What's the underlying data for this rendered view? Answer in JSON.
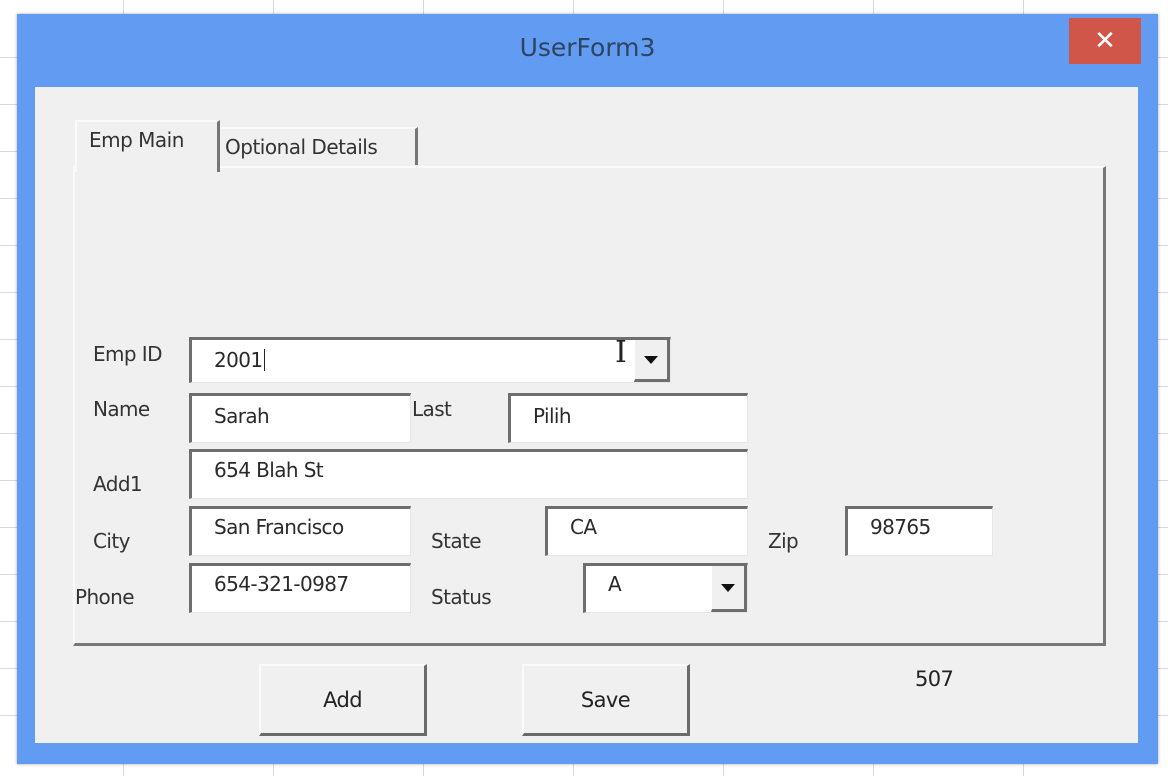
{
  "window": {
    "title": "UserForm3",
    "close_icon": "close-x-icon",
    "colors": {
      "titlebar": "#619cf2",
      "close": "#d0564a",
      "client": "#f0f0f0"
    }
  },
  "tabs": [
    {
      "label": "Emp Main",
      "active": true
    },
    {
      "label": "Optional Details",
      "active": false
    }
  ],
  "form": {
    "emp_id": {
      "label": "Emp ID",
      "value": "2001",
      "dropdown_icon": "dropdown-arrow-icon"
    },
    "name": {
      "label": "Name",
      "value": "Sarah"
    },
    "last": {
      "label": "Last",
      "value": "Pilih"
    },
    "add1": {
      "label": "Add1",
      "value": "654 Blah St"
    },
    "city": {
      "label": "City",
      "value": "San Francisco"
    },
    "state": {
      "label": "State",
      "value": "CA"
    },
    "zip": {
      "label": "Zip",
      "value": "98765"
    },
    "phone": {
      "label": "Phone",
      "value": "654-321-0987"
    },
    "status": {
      "label": "Status",
      "value": "A",
      "dropdown_icon": "dropdown-arrow-icon"
    }
  },
  "buttons": {
    "add": "Add",
    "save": "Save"
  },
  "counter_label": "507"
}
